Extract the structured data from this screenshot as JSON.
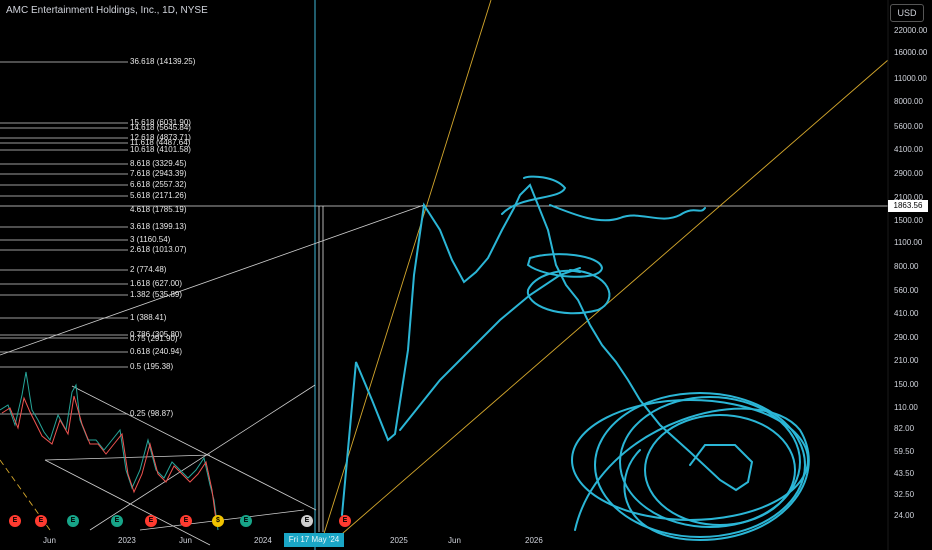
{
  "title": "AMC Entertainment Holdings, Inc., 1D, NYSE",
  "currency_button": "USD",
  "price_axis": [
    "22000.00",
    "16000.00",
    "11000.00",
    "8000.00",
    "5600.00",
    "4100.00",
    "2900.00",
    "2100.00",
    "1500.00",
    "1100.00",
    "800.00",
    "560.00",
    "410.00",
    "290.00",
    "210.00",
    "150.00",
    "110.00",
    "82.00",
    "59.50",
    "43.50",
    "32.50",
    "24.00"
  ],
  "current_price": "1863.56",
  "fib_levels": [
    "36.618 (14139.25)",
    "15.618 (6031.90)",
    "14.618 (5645.84)",
    "12.618 (4873.71)",
    "11.618 (4487.64)",
    "10.618 (4101.58)",
    "8.618 (3329.45)",
    "7.618 (2943.39)",
    "6.618 (2557.32)",
    "5.618 (2171.26)",
    "4.618 (1785.19)",
    "3.618 (1399.13)",
    "3 (1160.54)",
    "2.618 (1013.07)",
    "2 (774.48)",
    "1.618 (627.00)",
    "1.382 (535.89)",
    "1 (388.41)",
    "0.786 (305.80)",
    "0.75 (291.90)",
    "0.618 (240.94)",
    "0.5 (195.38)",
    "0.25 (98.87)"
  ],
  "time_axis": [
    "Jun",
    "2023",
    "Jun",
    "2024",
    "2025",
    "Jun",
    "2026"
  ],
  "crosshair_date": "Fri 17 May '24",
  "events": [
    {
      "icon": "earnings-icon",
      "label": "E",
      "color": "#ff3b30"
    },
    {
      "icon": "earnings-icon",
      "label": "E",
      "color": "#ff3b30"
    },
    {
      "icon": "earnings-icon",
      "label": "E",
      "color": "#17a589"
    },
    {
      "icon": "earnings-icon",
      "label": "E",
      "color": "#17a589"
    },
    {
      "icon": "earnings-icon",
      "label": "E",
      "color": "#ff3b30"
    },
    {
      "icon": "earnings-icon",
      "label": "E",
      "color": "#ff3b30"
    },
    {
      "icon": "dividend-icon",
      "label": "$",
      "color": "#f0c300"
    },
    {
      "icon": "earnings-icon",
      "label": "E",
      "color": "#17a589"
    },
    {
      "icon": "earnings-icon",
      "label": "E",
      "color": "#cfcfcf"
    },
    {
      "icon": "earnings-icon",
      "label": "E",
      "color": "#ff3b30"
    }
  ],
  "colors": {
    "background": "#000000",
    "crosshair": "#3fb8d8",
    "drawing": "#2bb6d6",
    "trendline": "#d4a72c"
  }
}
